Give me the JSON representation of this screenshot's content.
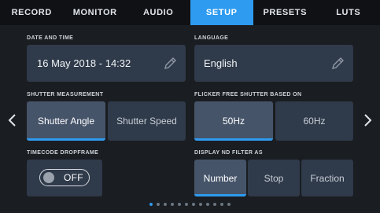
{
  "tabs": [
    {
      "label": "RECORD"
    },
    {
      "label": "MONITOR"
    },
    {
      "label": "AUDIO"
    },
    {
      "label": "SETUP"
    },
    {
      "label": "PRESETS"
    },
    {
      "label": "LUTS"
    }
  ],
  "active_tab": "SETUP",
  "date_time": {
    "label": "DATE AND TIME",
    "value": "16 May 2018 - 14:32",
    "icon": "pencil-icon"
  },
  "language": {
    "label": "LANGUAGE",
    "value": "English",
    "icon": "pencil-icon"
  },
  "shutter_measurement": {
    "label": "SHUTTER MEASUREMENT",
    "options": [
      "Shutter Angle",
      "Shutter Speed"
    ],
    "selected": "Shutter Angle"
  },
  "flicker_free": {
    "label": "FLICKER FREE SHUTTER BASED ON",
    "options": [
      "50Hz",
      "60Hz"
    ],
    "selected": "50Hz"
  },
  "timecode_dropframe": {
    "label": "TIMECODE DROPFRAME",
    "state": "OFF"
  },
  "nd_filter": {
    "label": "DISPLAY ND FILTER AS",
    "options": [
      "Number",
      "Stop",
      "Fraction"
    ],
    "selected": "Number"
  },
  "nav": {
    "prev_icon": "chevron-left-icon",
    "next_icon": "chevron-right-icon"
  },
  "pagination": {
    "total": 12,
    "current": 1
  },
  "colors": {
    "accent": "#2e9bf0",
    "panel": "#2f3a4a",
    "background": "#1a1d21"
  }
}
